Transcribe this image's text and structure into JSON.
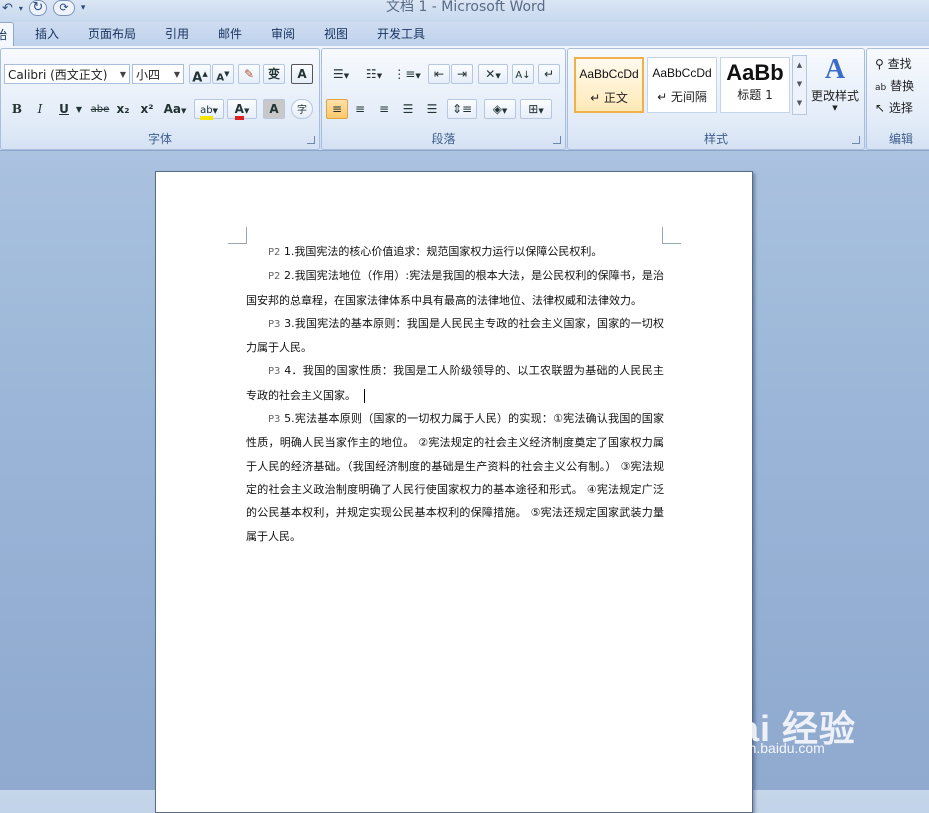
{
  "window": {
    "title": "文档 1 - Microsoft Word"
  },
  "tabs": [
    {
      "label": "始",
      "active": true
    },
    {
      "label": "插入"
    },
    {
      "label": "页面布局"
    },
    {
      "label": "引用"
    },
    {
      "label": "邮件"
    },
    {
      "label": "审阅"
    },
    {
      "label": "视图"
    },
    {
      "label": "开发工具"
    }
  ],
  "ribbon": {
    "font": {
      "group_label": "字体",
      "font_name": "Calibri (西文正文)",
      "font_size": "小四",
      "bold": "B",
      "italic": "I",
      "underline": "U",
      "strike": "abe",
      "subscript": "x₂",
      "superscript": "x²",
      "case": "Aa",
      "grow": "A",
      "shrink": "A",
      "clear": "A",
      "phonetic": "变",
      "border_char": "A",
      "highlight": "ab",
      "font_color": "A",
      "shade": "A",
      "enclose": "字"
    },
    "paragraph": {
      "group_label": "段落"
    },
    "styles": {
      "group_label": "样式",
      "items": [
        {
          "sample": "AaBbCcDd",
          "name": "↵ 正文",
          "selected": true
        },
        {
          "sample": "AaBbCcDd",
          "name": "↵ 无间隔"
        },
        {
          "sample": "AaBb",
          "name": "标题 1"
        }
      ],
      "change_styles": "更改样式"
    },
    "editing": {
      "group_label": "编辑",
      "find": "查找",
      "replace": "替换",
      "select": "选择"
    }
  },
  "document": {
    "paragraphs": [
      {
        "page": "P2",
        "text": "1.我国宪法的核心价值追求：规范国家权力运行以保障公民权利。"
      },
      {
        "page": "P2",
        "text": "2.我国宪法地位（作用）:宪法是我国的根本大法，是公民权利的保障书，是治国安邦的总章程，在国家法律体系中具有最高的法律地位、法律权威和法律效力。"
      },
      {
        "page": "P3",
        "text": "3.我国宪法的基本原则：我国是人民民主专政的社会主义国家，国家的一切权力属于人民。"
      },
      {
        "page": "P3",
        "text": "4．我国的国家性质：我国是工人阶级领导的、以工农联盟为基础的人民民主专政的社会主义国家。"
      },
      {
        "page": "P3",
        "text": "5.宪法基本原则（国家的一切权力属于人民）的实现：①宪法确认我国的国家性质，明确人民当家作主的地位。 ②宪法规定的社会主义经济制度奠定了国家权力属于人民的经济基础。（我国经济制度的基础是生产资料的社会主义公有制。） ③宪法规定的社会主义政治制度明确了人民行使国家权力的基本途径和形式。 ④宪法规定广泛的公民基本权利，并规定实现公民基本权利的保障措施。 ⑤宪法还规定国家武装力量属于人民。"
      }
    ]
  },
  "watermark": {
    "brand": "Bai 经验",
    "url": "jingyan.baidu.com"
  }
}
